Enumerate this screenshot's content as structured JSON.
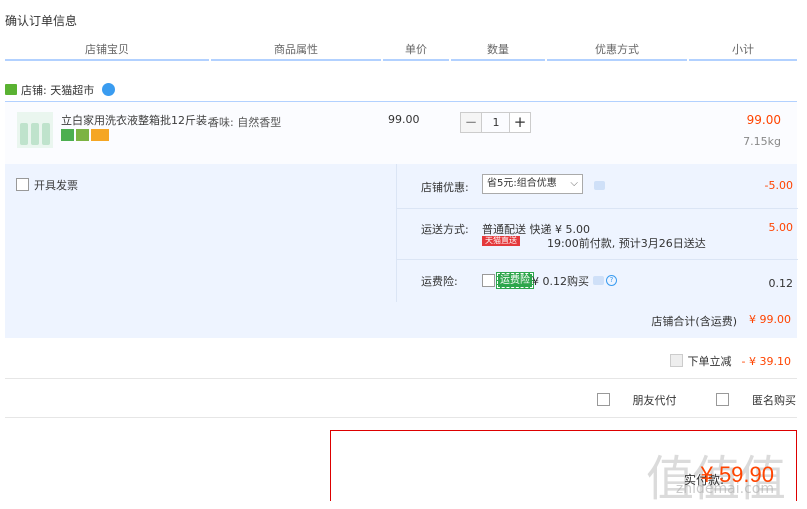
{
  "page": {
    "title": "确认订单信息"
  },
  "table_header": {
    "columns": [
      "店铺宝贝",
      "商品属性",
      "单价",
      "数量",
      "优惠方式",
      "小计"
    ]
  },
  "store": {
    "label": "店铺:",
    "name": "天猫超市"
  },
  "item": {
    "name": "立白家用洗衣液整箱批12斤装...",
    "attribute": "香味: 自然香型",
    "price": "99.00",
    "quantity": "1",
    "qty_minus": "−",
    "qty_plus": "+",
    "subtotal": "99.00",
    "weight": "7.15kg"
  },
  "options": {
    "invoice_label": "开具发票",
    "coupon": {
      "label": "店铺优惠:",
      "selected": "省5元:组合优惠",
      "amount": "-5.00"
    },
    "shipping": {
      "label": "运送方式:",
      "method": "普通配送 快递 ¥ 5.00",
      "badge": "天猫直送",
      "eta": "19:00前付款, 预计3月26日送达",
      "amount": "5.00"
    },
    "insurance": {
      "label": "运费险:",
      "tag": "运费险",
      "text": "¥ 0.12购买",
      "help": "?",
      "amount": "0.12"
    },
    "store_total": {
      "label": "店铺合计(含运费)",
      "amount": "¥ 99.00"
    }
  },
  "discount": {
    "label": "下单立减",
    "amount": "- ¥ 39.10"
  },
  "social": {
    "friend_pay": "朋友代付",
    "anonymous": "匿名购买"
  },
  "payment": {
    "label": "实付款:",
    "amount": "¥ 59.90"
  },
  "watermark": {
    "text": "值值值",
    "site": "zhidemai.com"
  }
}
